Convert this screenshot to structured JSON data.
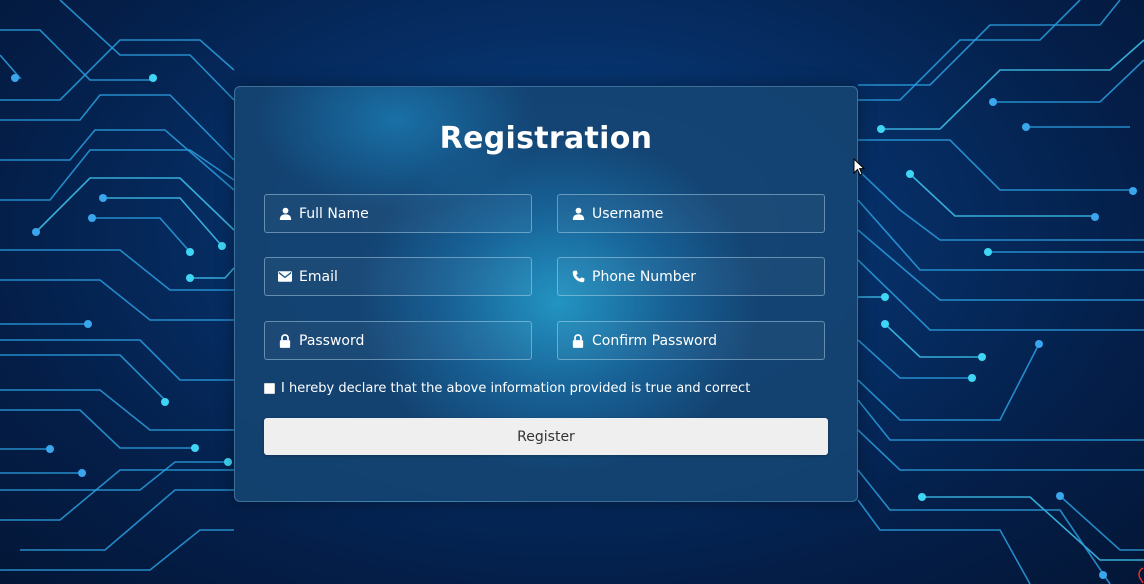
{
  "form": {
    "title": "Registration",
    "fields": [
      {
        "name": "full-name",
        "placeholder": "Full Name",
        "icon": "person-icon"
      },
      {
        "name": "username",
        "placeholder": "Username",
        "icon": "person-icon"
      },
      {
        "name": "email",
        "placeholder": "Email",
        "icon": "envelope-icon"
      },
      {
        "name": "phone-number",
        "placeholder": "Phone Number",
        "icon": "phone-icon"
      },
      {
        "name": "password",
        "placeholder": "Password",
        "icon": "lock-icon"
      },
      {
        "name": "confirm-password",
        "placeholder": "Confirm Password",
        "icon": "lock-icon"
      }
    ],
    "declaration": {
      "checked": false,
      "label": "I hereby declare that the above information provided is true and correct"
    },
    "submit_label": "Register"
  },
  "colors": {
    "background": "#041f4a",
    "circuit": "#2a9fe0",
    "circuit_node": "#3fd6f5",
    "button_bg": "#efefef",
    "button_text": "#333333"
  }
}
